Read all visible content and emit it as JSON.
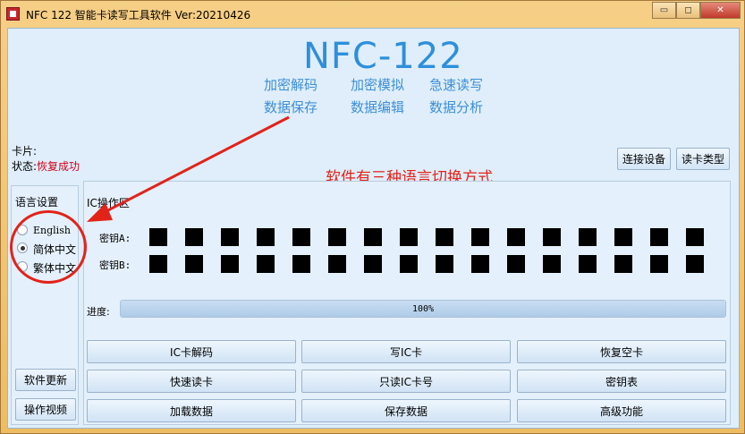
{
  "window": {
    "title": "NFC 122 智能卡读写工具软件 Ver:20210426",
    "controls": {
      "minimize": "▭",
      "maximize": "◻",
      "close": "✕"
    }
  },
  "header": {
    "brand": "NFC-122",
    "features": [
      "加密解码",
      "加密模拟",
      "急速读写",
      "数据保存",
      "数据编辑",
      "数据分析"
    ]
  },
  "card": {
    "label": "卡片:",
    "status_label": "状态:",
    "status_value": "恢复成功"
  },
  "top_buttons": {
    "connect": "连接设备",
    "card_type": "读卡类型"
  },
  "annotation": "软件有三种语言切换方式",
  "language": {
    "title": "语言设置",
    "options": [
      {
        "label": "English",
        "checked": false
      },
      {
        "label": "简体中文",
        "checked": true
      },
      {
        "label": "繁体中文",
        "checked": false
      }
    ]
  },
  "side_buttons": {
    "update": "软件更新",
    "video": "操作视频"
  },
  "ic_area": {
    "title": "IC操作区",
    "key_a_label": "密钥A:",
    "key_b_label": "密钥B:",
    "key_count": 16
  },
  "progress": {
    "label": "进度:",
    "value": 100,
    "text": "100%"
  },
  "actions": [
    [
      "IC卡解码",
      "写IC卡",
      "恢复空卡"
    ],
    [
      "快速读卡",
      "只读IC卡号",
      "密钥表"
    ],
    [
      "加载数据",
      "保存数据",
      "高级功能"
    ]
  ],
  "colors": {
    "brand": "#2e8fdb",
    "feature": "#3d8fd6",
    "annotation": "#e2231a",
    "status": "#d0021b"
  }
}
